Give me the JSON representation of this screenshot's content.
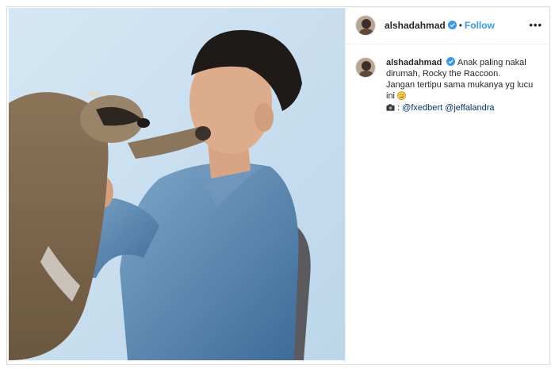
{
  "post": {
    "username": "alshadahmad",
    "follow_label": "Follow",
    "separator": "•",
    "more_label": "•••"
  },
  "caption": {
    "username": "alshadahmad",
    "line1": "Anak paling nakal dirumah, Rocky the Raccoon.",
    "line2": "Jangan tertipu sama mukanya yg lucu ini",
    "credit_prefix": ":",
    "mention1": "@fxedbert",
    "mention2": "@jeffalandra"
  },
  "icons": {
    "verified": "verified-badge-icon",
    "camera": "camera-icon",
    "emoji": "smirk-emoji-icon",
    "more": "more-options-icon"
  },
  "colors": {
    "accent": "#3897f0",
    "verified": "#3897f0",
    "mention": "#003569",
    "background": "#c9dff0"
  }
}
